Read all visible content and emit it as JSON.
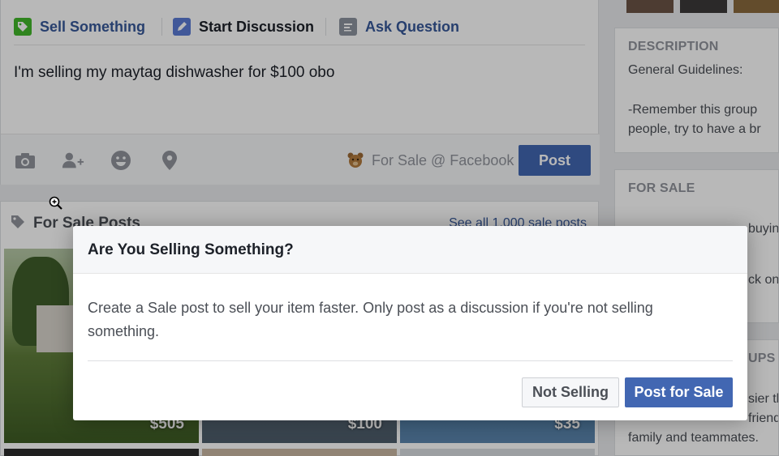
{
  "composer": {
    "tabs": [
      {
        "label": "Sell Something",
        "icon": "tag-icon"
      },
      {
        "label": "Start Discussion",
        "icon": "pencil-icon"
      },
      {
        "label": "Ask Question",
        "icon": "list-icon"
      }
    ],
    "text": "I'm selling my maytag dishwasher for $100 obo",
    "actions": [
      "camera-icon",
      "tag-friends-icon",
      "emoji-icon",
      "location-pin-icon"
    ],
    "audience": "For Sale @ Facebook",
    "post_label": "Post"
  },
  "sale_posts": {
    "title": "For Sale Posts",
    "see_all": "See all 1,000 sale posts",
    "items": [
      {
        "price": "$505"
      },
      {
        "price": "$100"
      },
      {
        "price": "$35"
      }
    ]
  },
  "right_column": {
    "description": {
      "title": "DESCRIPTION",
      "line1": "General Guidelines:",
      "line2": "-Remember this group",
      "line3": "people, try to have a br"
    },
    "for_sale": {
      "title": "FOR SALE",
      "line1": "buyin",
      "line2": "ck on"
    },
    "groups": {
      "title": "UPS",
      "line1": "sier th",
      "line2": "friend",
      "line3": "family and teammates."
    }
  },
  "dialog": {
    "title": "Are You Selling Something?",
    "body": "Create a Sale post to sell your item faster. Only post as a discussion if you're not selling something.",
    "secondary_label": "Not Selling",
    "primary_label": "Post for Sale"
  },
  "colors": {
    "brand_blue": "#4267b2",
    "link_blue": "#365899",
    "sell_green": "#42b72a"
  }
}
